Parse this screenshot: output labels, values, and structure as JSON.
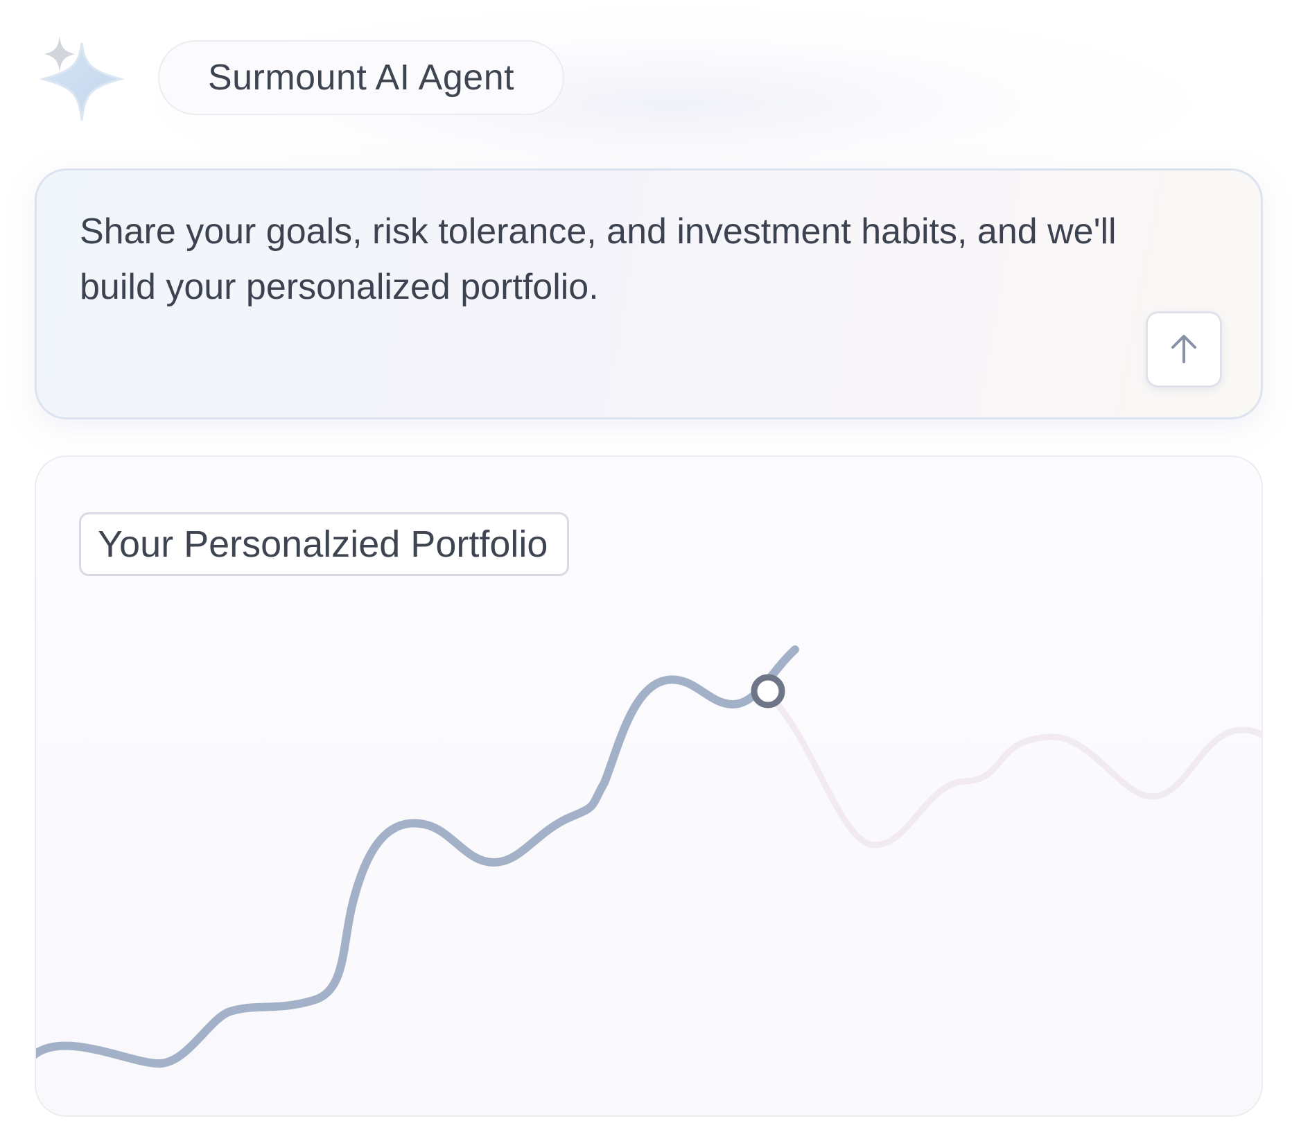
{
  "header": {
    "logo_icon": "sparkle-icon",
    "agent_name": "Surmount AI Agent"
  },
  "prompt": {
    "text": "Share your goals, risk tolerance, and investment habits, and we'll build your personalized portfolio.",
    "send_icon": "arrow-up-icon"
  },
  "portfolio": {
    "title": "Your Personalzied Portfolio"
  },
  "colors": {
    "line": "#a3b1c8",
    "faded_line": "#f0e9ee",
    "marker": "#6e7586"
  }
}
